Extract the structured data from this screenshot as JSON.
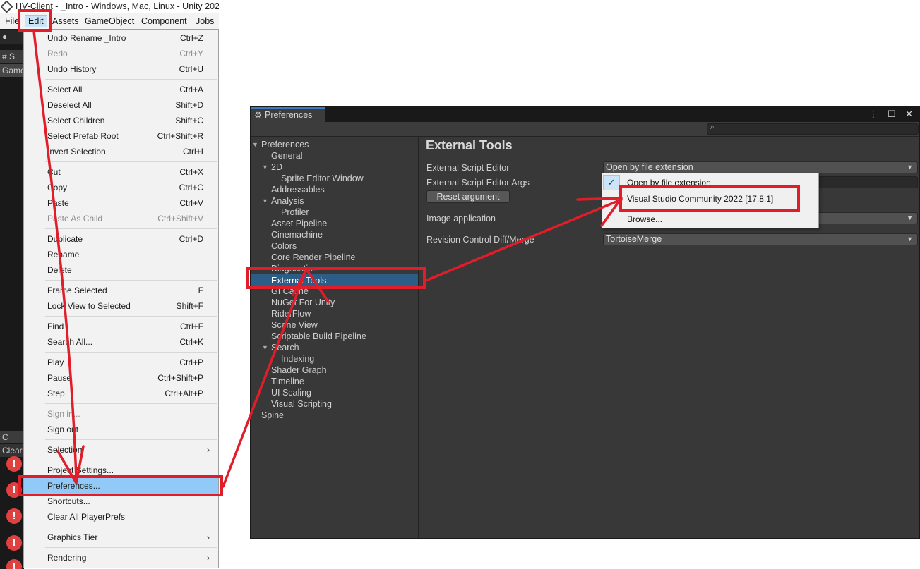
{
  "window": {
    "title": "HV-Client - _Intro - Windows, Mac, Linux - Unity 202"
  },
  "menubar": {
    "items": [
      "File",
      "Edit",
      "Assets",
      "GameObject",
      "Component",
      "Jobs"
    ]
  },
  "editor_strip": {
    "scene_tab": "# S",
    "game_tab": "Game",
    "console_tab": "C",
    "clear": "Clear",
    "error_glyph": "!"
  },
  "edit_menu": {
    "items": [
      {
        "label": "Undo Rename _Intro",
        "shortcut": "Ctrl+Z"
      },
      {
        "label": "Redo",
        "shortcut": "Ctrl+Y",
        "disabled": true
      },
      {
        "label": "Undo History",
        "shortcut": "Ctrl+U"
      },
      {
        "label": "Select All",
        "shortcut": "Ctrl+A"
      },
      {
        "label": "Deselect All",
        "shortcut": "Shift+D"
      },
      {
        "label": "Select Children",
        "shortcut": "Shift+C"
      },
      {
        "label": "Select Prefab Root",
        "shortcut": "Ctrl+Shift+R"
      },
      {
        "label": "Invert Selection",
        "shortcut": "Ctrl+I"
      },
      {
        "label": "Cut",
        "shortcut": "Ctrl+X"
      },
      {
        "label": "Copy",
        "shortcut": "Ctrl+C"
      },
      {
        "label": "Paste",
        "shortcut": "Ctrl+V"
      },
      {
        "label": "Paste As Child",
        "shortcut": "Ctrl+Shift+V",
        "disabled": true
      },
      {
        "label": "Duplicate",
        "shortcut": "Ctrl+D"
      },
      {
        "label": "Rename",
        "shortcut": ""
      },
      {
        "label": "Delete",
        "shortcut": ""
      },
      {
        "label": "Frame Selected",
        "shortcut": "F"
      },
      {
        "label": "Lock View to Selected",
        "shortcut": "Shift+F"
      },
      {
        "label": "Find",
        "shortcut": "Ctrl+F"
      },
      {
        "label": "Search All...",
        "shortcut": "Ctrl+K"
      },
      {
        "label": "Play",
        "shortcut": "Ctrl+P"
      },
      {
        "label": "Pause",
        "shortcut": "Ctrl+Shift+P"
      },
      {
        "label": "Step",
        "shortcut": "Ctrl+Alt+P"
      },
      {
        "label": "Sign in...",
        "shortcut": "",
        "disabled": true
      },
      {
        "label": "Sign out",
        "shortcut": ""
      },
      {
        "label": "Selection",
        "shortcut": "",
        "submenu": true
      },
      {
        "label": "Project Settings...",
        "shortcut": ""
      },
      {
        "label": "Preferences...",
        "shortcut": "",
        "highlighted": true
      },
      {
        "label": "Shortcuts...",
        "shortcut": ""
      },
      {
        "label": "Clear All PlayerPrefs",
        "shortcut": ""
      },
      {
        "label": "Graphics Tier",
        "shortcut": "",
        "submenu": true
      },
      {
        "label": "Rendering",
        "shortcut": "",
        "submenu": true
      }
    ],
    "submenu_arrow": "›"
  },
  "preferences": {
    "tab_title": "Preferences",
    "tab_icon": "gear-icon",
    "window_buttons": "⋮ ☐ ✕",
    "search_glyph": "🔍",
    "tree": [
      {
        "label": "Preferences",
        "level": 0,
        "expanded": true
      },
      {
        "label": "General",
        "level": 1
      },
      {
        "label": "2D",
        "level": 1,
        "expanded": true
      },
      {
        "label": "Sprite Editor Window",
        "level": 2
      },
      {
        "label": "Addressables",
        "level": 1
      },
      {
        "label": "Analysis",
        "level": 1,
        "expanded": true
      },
      {
        "label": "Profiler",
        "level": 2
      },
      {
        "label": "Asset Pipeline",
        "level": 1
      },
      {
        "label": "Cinemachine",
        "level": 1
      },
      {
        "label": "Colors",
        "level": 1
      },
      {
        "label": "Core Render Pipeline",
        "level": 1
      },
      {
        "label": "Diagnostics",
        "level": 1
      },
      {
        "label": "External Tools",
        "level": 1,
        "selected": true
      },
      {
        "label": "GI Cache",
        "level": 1
      },
      {
        "label": "NuGet For Unity",
        "level": 1
      },
      {
        "label": "RiderFlow",
        "level": 1
      },
      {
        "label": "Scene View",
        "level": 1
      },
      {
        "label": "Scriptable Build Pipeline",
        "level": 1
      },
      {
        "label": "Search",
        "level": 1,
        "expanded": true
      },
      {
        "label": "Indexing",
        "level": 2
      },
      {
        "label": "Shader Graph",
        "level": 1
      },
      {
        "label": "Timeline",
        "level": 1
      },
      {
        "label": "UI Scaling",
        "level": 1
      },
      {
        "label": "Visual Scripting",
        "level": 1
      },
      {
        "label": "Spine",
        "level": 0
      }
    ],
    "content": {
      "heading": "External Tools",
      "external_script_editor_label": "External Script Editor",
      "external_script_editor_value": "Open by file extension",
      "external_script_editor_args_label": "External Script Editor Args",
      "reset_argument_label": "Reset argument",
      "image_application_label": "Image application",
      "revision_control_label": "Revision Control Diff/Merge",
      "revision_control_value": "TortoiseMerge"
    },
    "popup": {
      "items": [
        {
          "label": "Open by file extension",
          "checked": true
        },
        {
          "label": "Visual Studio Community 2022 [17.8.1]"
        },
        {
          "label": "Browse..."
        }
      ],
      "check_glyph": "✓"
    },
    "tree_triangle": "▼",
    "dropdown_caret": "▼"
  },
  "colors": {
    "annotation_red": "#e11d2a",
    "selection_blue": "#2c5d87",
    "menu_highlight": "#91c9f7"
  }
}
